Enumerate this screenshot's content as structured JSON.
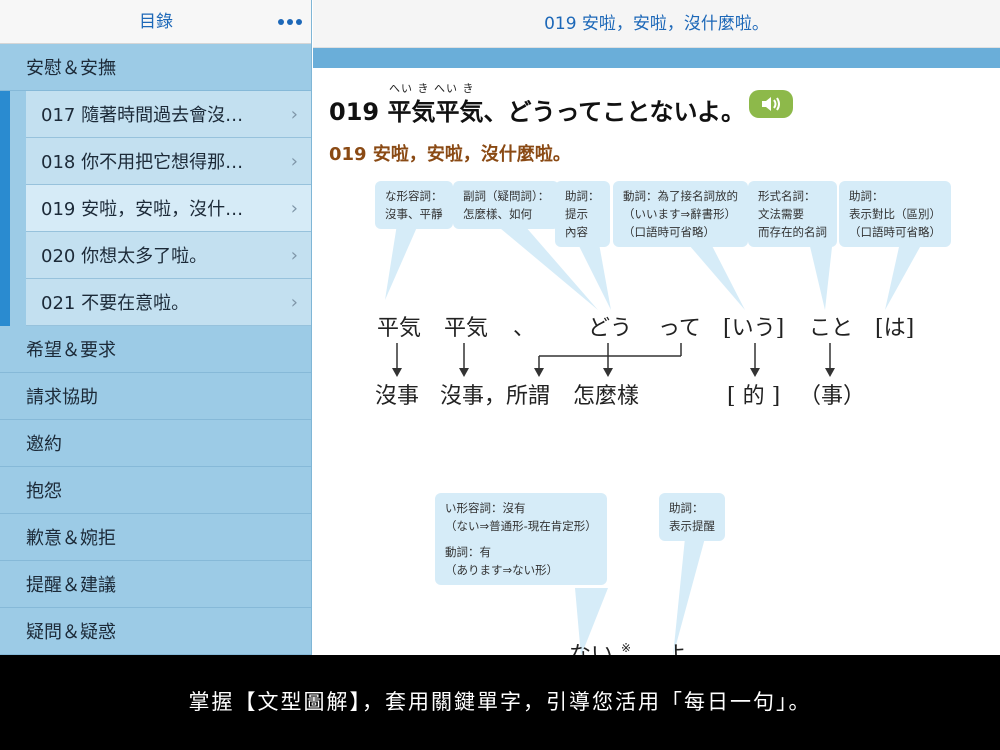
{
  "sidebar": {
    "title": "目錄",
    "items": [
      {
        "label": "安慰＆安撫",
        "type": "category"
      },
      {
        "label": "017 隨著時間過去會沒…",
        "type": "sub"
      },
      {
        "label": "018 你不用把它想得那…",
        "type": "sub"
      },
      {
        "label": "019 安啦，安啦，沒什…",
        "type": "sub",
        "selected": true
      },
      {
        "label": "020 你想太多了啦。",
        "type": "sub"
      },
      {
        "label": "021 不要在意啦。",
        "type": "sub"
      },
      {
        "label": "希望＆要求",
        "type": "category"
      },
      {
        "label": "請求協助",
        "type": "category"
      },
      {
        "label": "邀約",
        "type": "category"
      },
      {
        "label": "抱怨",
        "type": "category"
      },
      {
        "label": "歉意＆婉拒",
        "type": "category"
      },
      {
        "label": "提醒＆建議",
        "type": "category"
      },
      {
        "label": "疑問＆疑惑",
        "type": "category"
      }
    ]
  },
  "main": {
    "header_title": "019 安啦，安啦，沒什麼啦。",
    "ruby": "へい き へい き",
    "headline": "019 平気平気、どうってことないよ。",
    "translation": "019 安啦，安啦，沒什麼啦。"
  },
  "bubbles": [
    {
      "lines": [
        "な形容詞：",
        "沒事、平靜"
      ]
    },
    {
      "lines": [
        "副詞（疑問詞）：",
        "怎麼樣、如何"
      ]
    },
    {
      "lines": [
        "助詞：",
        "提示",
        "內容"
      ]
    },
    {
      "lines": [
        "動詞：為了接名詞放的",
        "（いいます⇒辭書形）",
        "（口語時可省略）"
      ]
    },
    {
      "lines": [
        "形式名詞：",
        "文法需要",
        "而存在的名詞"
      ]
    },
    {
      "lines": [
        "助詞：",
        "表示對比（區別）",
        "（口語時可省略）"
      ]
    },
    {
      "lines": [
        "い形容詞：沒有",
        "（ない⇒普通形-現在肯定形）",
        "",
        "動詞：有",
        "（あります⇒ない形）"
      ]
    },
    {
      "lines": [
        "助詞：",
        "表示提醒"
      ]
    }
  ],
  "diagram": {
    "words": [
      "平気",
      "平気",
      "、",
      "どう",
      "って",
      "[いう]",
      "こと",
      "[は]",
      "ない",
      "※",
      "よ"
    ],
    "meanings": [
      "沒事",
      "沒事，所謂",
      "怎麼樣",
      "[ 的 ]",
      "（事）"
    ]
  },
  "caption": "掌握【文型圖解】，套用關鍵單字，引導您活用「每日一句」。",
  "colors": {
    "accent": "#1d68b8",
    "sidebar_bg": "#9ccbe6",
    "sub_bg": "#c3e0f0",
    "bubble": "#d6ecf8",
    "audio": "#8db94a",
    "translation": "#8a4a14"
  },
  "icons": [
    "more-dots-icon",
    "chevron-right-icon",
    "speaker-icon"
  ]
}
